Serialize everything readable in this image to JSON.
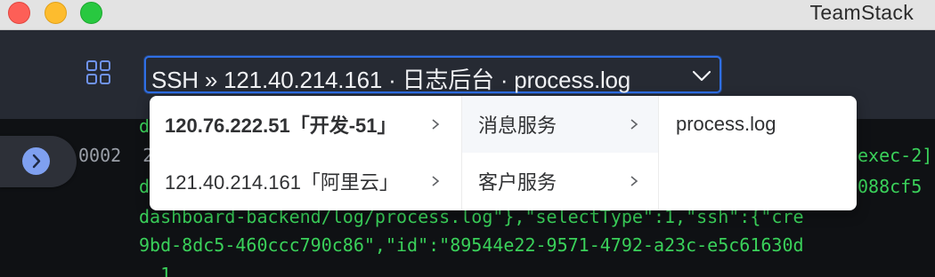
{
  "window": {
    "app_title": "TeamStack"
  },
  "toolbar": {
    "grid_icon": "grid-icon",
    "path_label": "SSH » 121.40.214.161 · 日志后台 · process.log",
    "dropdown_icon": "chevron-down-icon"
  },
  "terminal": {
    "lines": [
      "d",
      "0002  2",
      "d",
      "dashboard-backend/log/process.log\"},\"selectType\":1,\"ssh\":{\"cre",
      "9bd-8dc5-460ccc790c86\",\"id\":\"89544e22-9571-4792-a23c-e5c61630d",
      "  1",
      "exec-2]",
      "088cf5"
    ]
  },
  "cascade": {
    "servers": [
      {
        "label": "120.76.222.51「开发-51」",
        "active": false,
        "bold": true
      },
      {
        "label": "121.40.214.161「阿里云」",
        "active": false,
        "bold": false
      }
    ],
    "services": [
      {
        "label": "消息服务",
        "active": true
      },
      {
        "label": "客户服务",
        "active": false
      }
    ],
    "files": [
      {
        "label": "process.log"
      }
    ]
  },
  "colors": {
    "accent": "#2f6fe6",
    "terminal_text": "#3ad15a",
    "side_button": "#7fa0f0"
  }
}
